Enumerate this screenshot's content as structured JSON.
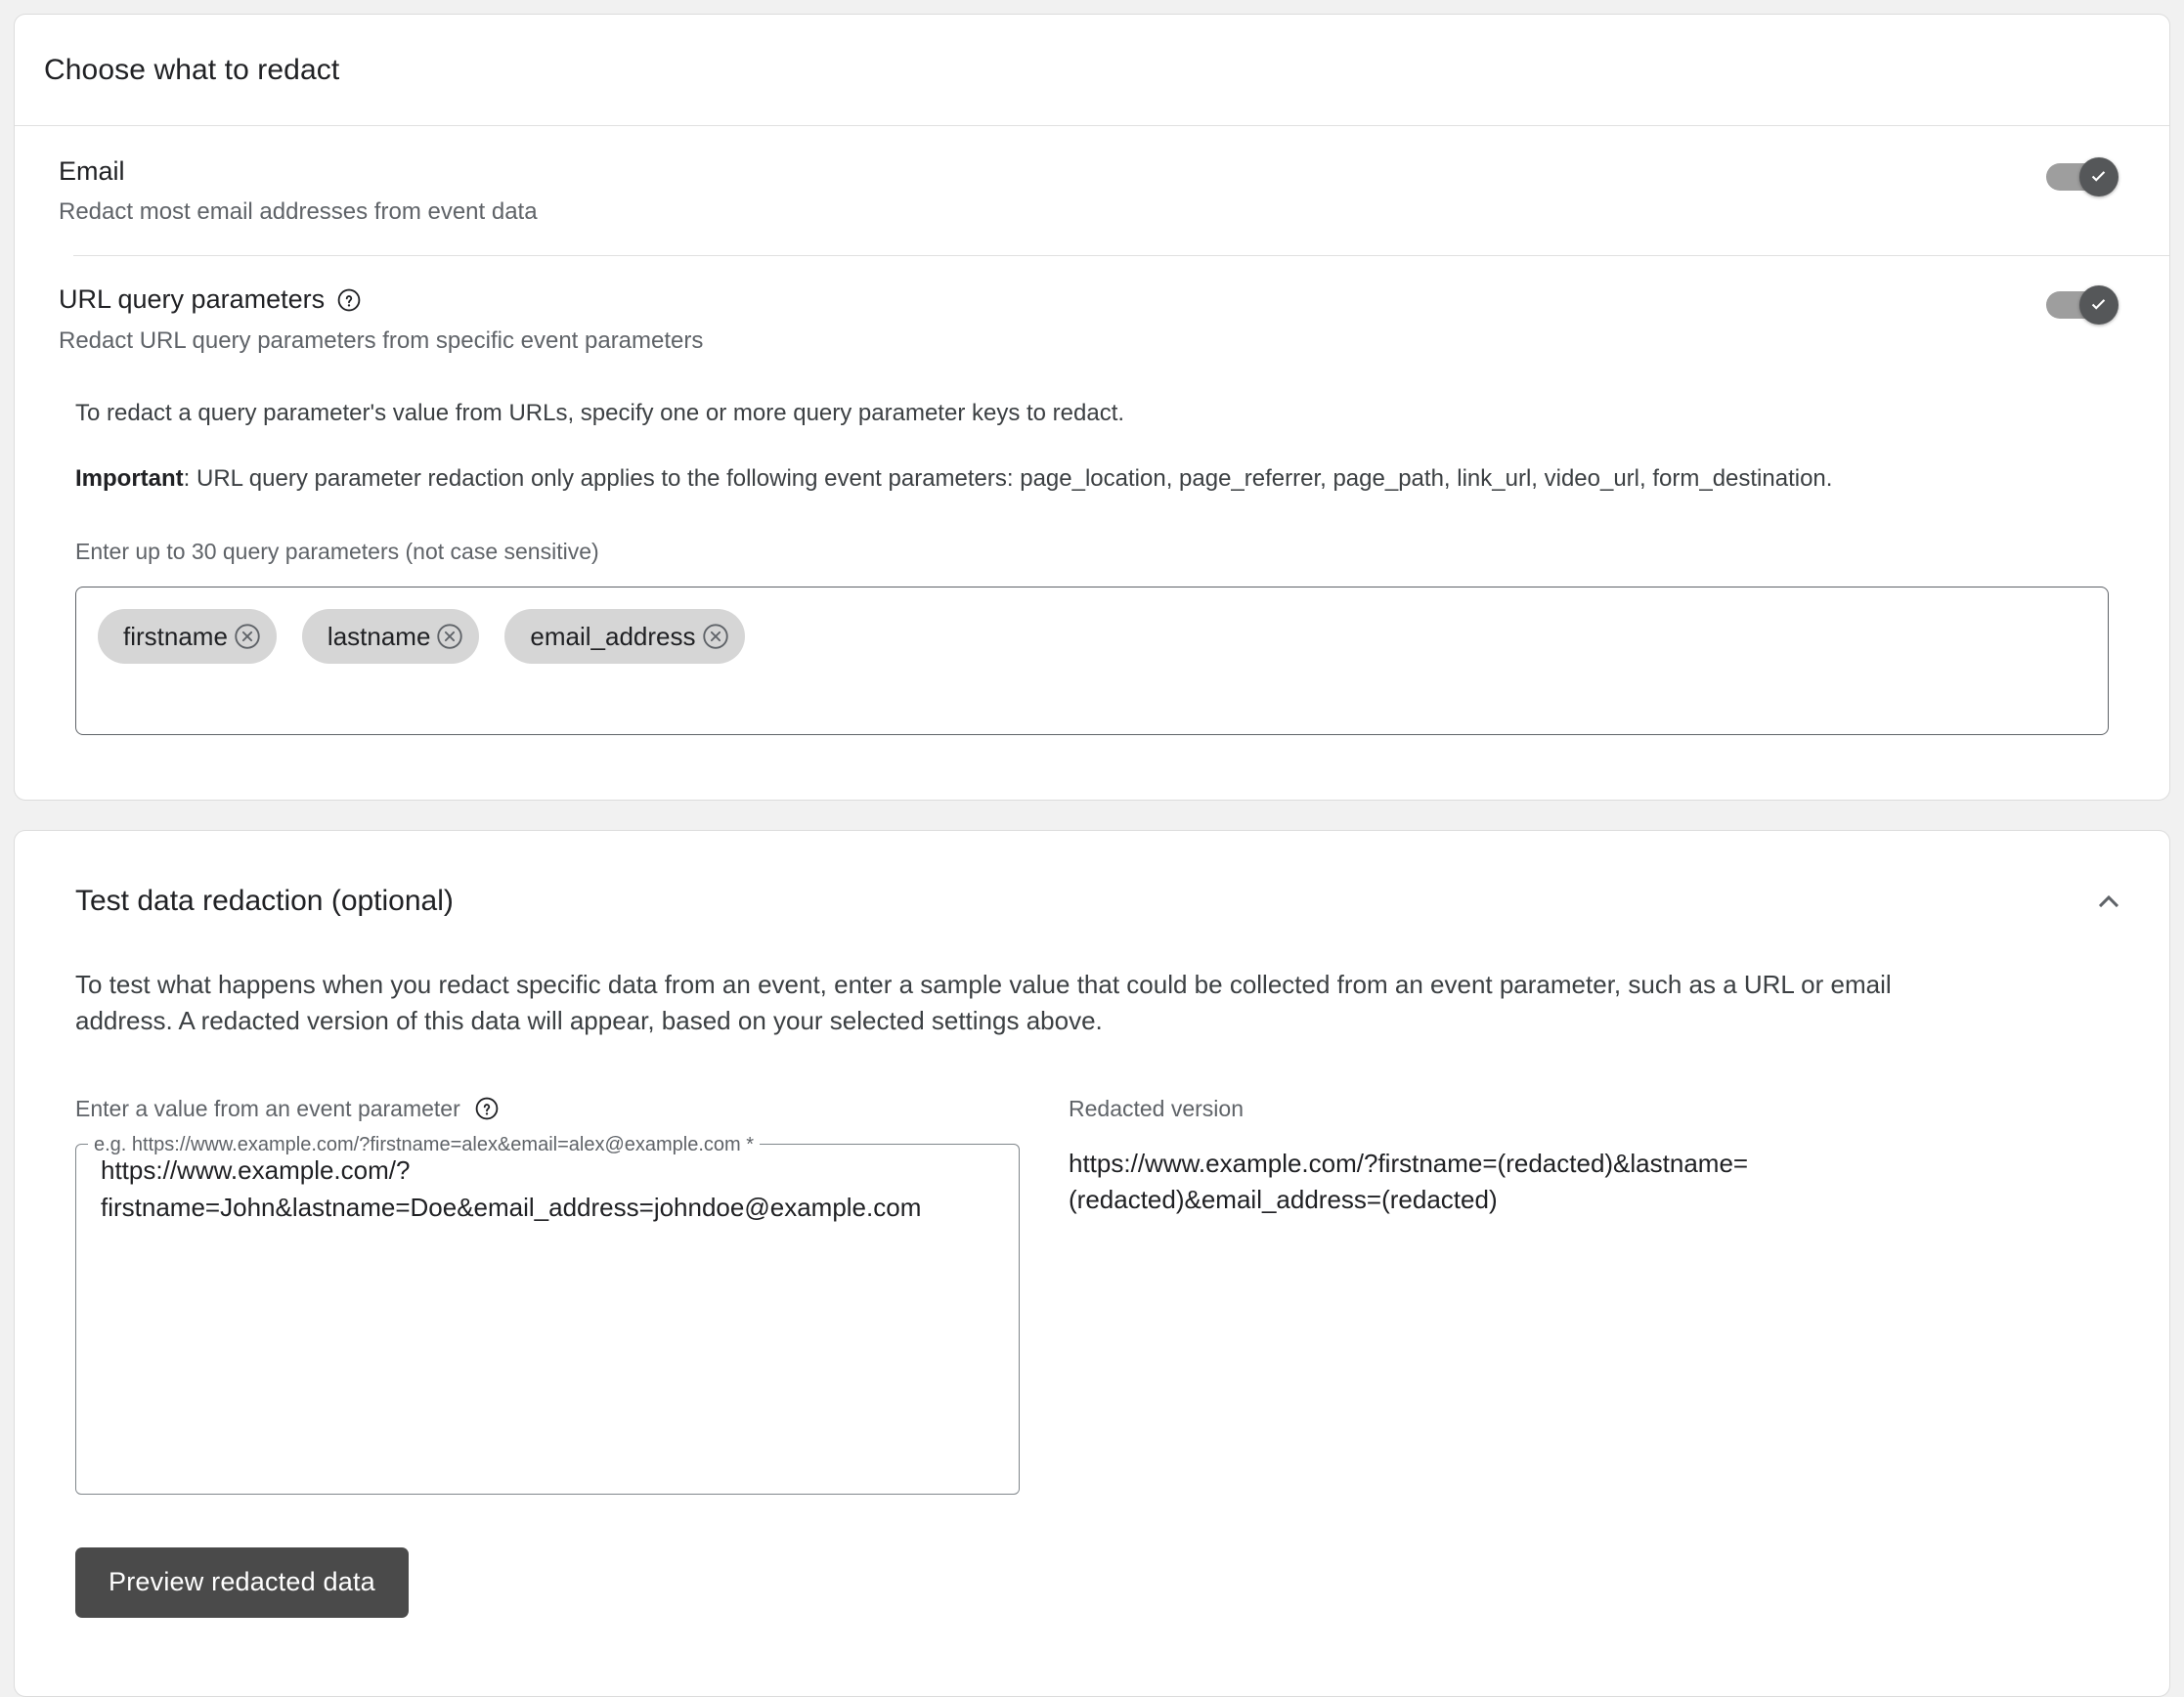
{
  "redact_card": {
    "title": "Choose what to redact",
    "settings": [
      {
        "name": "Email",
        "description": "Redact most email addresses from event data",
        "toggle_state": "on",
        "has_help": false
      },
      {
        "name": "URL query parameters",
        "description": "Redact URL query parameters from specific event parameters",
        "toggle_state": "on",
        "has_help": true
      }
    ],
    "lead_text": "To redact a query parameter's value from URLs, specify one or more query parameter keys to redact.",
    "important_label": "Important",
    "important_text": ": URL query parameter redaction only applies to the following event parameters: page_location, page_referrer, page_path, link_url, video_url, form_destination.",
    "chips_field_label": "Enter up to 30 query parameters (not case sensitive)",
    "chips": [
      "firstname",
      "lastname",
      "email_address"
    ],
    "chip_remove_icon": "close-circle-icon",
    "help_icon": "help-circle-icon"
  },
  "test_card": {
    "title": "Test data redaction (optional)",
    "collapse_icon": "chevron-up-icon",
    "intro": "To test what happens when you redact specific data from an event, enter a sample value that could be collected from an event parameter, such as a URL or email address. A redacted version of this data will appear, based on your selected settings above.",
    "input_label": "Enter a value from an event parameter",
    "input_help_icon": "help-circle-icon",
    "input_legend": "e.g. https://www.example.com/?firstname=alex&email=alex@example.com *",
    "input_placeholder": "e.g. https://www.example.com/?firstname=alex&email=alex@example.com",
    "input_value": "https://www.example.com/?\nfirstname=John&lastname=Doe&email_address=johndoe@example.com",
    "redacted_label": "Redacted version",
    "redacted_value": "https://www.example.com/?firstname=(redacted)&lastname=(redacted)&email_address=(redacted)",
    "preview_button": "Preview redacted data"
  },
  "colors": {
    "page_background": "#f1f1f1",
    "card_background": "#ffffff",
    "card_border": "#dcdcdc",
    "toggle_track": "#9e9e9e",
    "toggle_thumb": "#555759",
    "chip_background": "#d6d6d6",
    "button_background": "#4a4a4a",
    "text_primary": "#202124",
    "text_secondary": "#5f6368"
  }
}
